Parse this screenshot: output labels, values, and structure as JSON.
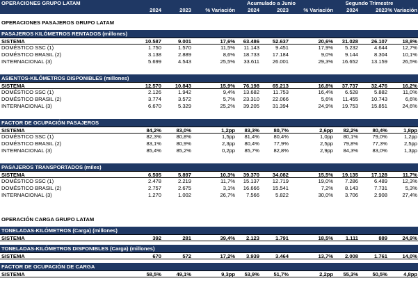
{
  "header": {
    "title": "OPERACIONES GRUPO LATAM",
    "groups": [
      "Acumulado a Junio",
      "Segundo Trimestre"
    ],
    "columns": [
      "2024",
      "2023",
      "% Variación",
      "2024",
      "2023",
      "% Variación",
      "2024",
      "2023",
      "% Variación"
    ]
  },
  "passenger_title": "OPERACIONES PASAJEROS GRUPO LATAM",
  "cargo_title": "OPERACIÓN CARGA GRUPO LATAM",
  "passenger_sections": [
    {
      "title": "PASAJEROS KILÓMETROS RENTADOS (millones)",
      "rows": [
        {
          "label": "SISTEMA",
          "v": [
            "10.587",
            "9.001",
            "17,6%",
            "63.486",
            "52.637",
            "20,6%",
            "31.028",
            "26.107",
            "18,8%"
          ]
        },
        {
          "label": "DOMÉSTICO SSC (1)",
          "v": [
            "1.750",
            "1.570",
            "11,5%",
            "11.143",
            "9.451",
            "17,9%",
            "5.232",
            "4.644",
            "12,7%"
          ]
        },
        {
          "label": "DOMÉSTICO BRASIL (2)",
          "v": [
            "3.138",
            "2.889",
            "8,6%",
            "18.733",
            "17.184",
            "9,0%",
            "9.144",
            "8.304",
            "10,1%"
          ]
        },
        {
          "label": "INTERNACIONAL (3)",
          "v": [
            "5.699",
            "4.543",
            "25,5%",
            "33.611",
            "26.001",
            "29,3%",
            "16.652",
            "13.159",
            "26,5%"
          ]
        }
      ]
    },
    {
      "title": "ASIENTOS-KILÓMETROS DISPONIBLES (millones)",
      "rows": [
        {
          "label": "SISTEMA",
          "v": [
            "12.570",
            "10.843",
            "15,9%",
            "76.198",
            "65.213",
            "16,8%",
            "37.737",
            "32.476",
            "16,2%"
          ]
        },
        {
          "label": "DOMÉSTICO SSC (1)",
          "v": [
            "2.126",
            "1.942",
            "9,4%",
            "13.682",
            "11.753",
            "16,4%",
            "6.528",
            "5.882",
            "11,0%"
          ]
        },
        {
          "label": "DOMÉSTICO BRASIL (2)",
          "v": [
            "3.774",
            "3.572",
            "5,7%",
            "23.310",
            "22.066",
            "5,6%",
            "11.455",
            "10.743",
            "6,6%"
          ]
        },
        {
          "label": "INTERNACIONAL (3)",
          "v": [
            "6.670",
            "5.329",
            "25,2%",
            "39.205",
            "31.394",
            "24,9%",
            "19.753",
            "15.851",
            "24,6%"
          ]
        }
      ]
    },
    {
      "title": "FACTOR DE OCUPACIÓN PASAJEROS",
      "rows": [
        {
          "label": "SISTEMA",
          "v": [
            "84,2%",
            "83,0%",
            "1,2pp",
            "83,3%",
            "80,7%",
            "2,6pp",
            "82,2%",
            "80,4%",
            "1,8pp"
          ]
        },
        {
          "label": "DOMÉSTICO SSC (1)",
          "v": [
            "82,3%",
            "80,8%",
            "1,5pp",
            "81,4%",
            "80,4%",
            "1,0pp",
            "80,1%",
            "79,0%",
            "1,2pp"
          ]
        },
        {
          "label": "DOMÉSTICO BRASIL (2)",
          "v": [
            "83,1%",
            "80,9%",
            "2,3pp",
            "80,4%",
            "77,9%",
            "2,5pp",
            "79,8%",
            "77,3%",
            "2,5pp"
          ]
        },
        {
          "label": "INTERNACIONAL (3)",
          "v": [
            "85,4%",
            "85,2%",
            "0,2pp",
            "85,7%",
            "82,8%",
            "2,9pp",
            "84,3%",
            "83,0%",
            "1,3pp"
          ]
        }
      ]
    },
    {
      "title": "PASAJEROS TRANSPORTADOS (miles)",
      "rows": [
        {
          "label": "SISTEMA",
          "v": [
            "6.505",
            "5.897",
            "10,3%",
            "39.370",
            "34.082",
            "15,5%",
            "19.135",
            "17.128",
            "11,7%"
          ]
        },
        {
          "label": "DOMÉSTICO SSC (1)",
          "v": [
            "2.478",
            "2.219",
            "11,7%",
            "15.137",
            "12.719",
            "19,0%",
            "7.286",
            "6.489",
            "12,3%"
          ]
        },
        {
          "label": "DOMÉSTICO BRASIL (2)",
          "v": [
            "2.757",
            "2.675",
            "3,1%",
            "16.666",
            "15.541",
            "7,2%",
            "8.143",
            "7.731",
            "5,3%"
          ]
        },
        {
          "label": "INTERNACIONAL (3)",
          "v": [
            "1.270",
            "1.002",
            "26,7%",
            "7.566",
            "5.822",
            "30,0%",
            "3.706",
            "2.908",
            "27,4%"
          ]
        }
      ]
    }
  ],
  "cargo_sections": [
    {
      "title": "TONELADAS-KILÓMETROS (Carga) (millones)",
      "rows": [
        {
          "label": "SISTEMA",
          "v": [
            "392",
            "281",
            "39,4%",
            "2.123",
            "1.791",
            "18,5%",
            "1.111",
            "889",
            "24,9%"
          ]
        }
      ]
    },
    {
      "title": "TONELADAS-KILÓMETROS DISPONIBLES (Carga) (millones)",
      "rows": [
        {
          "label": "SISTEMA",
          "v": [
            "670",
            "572",
            "17,2%",
            "3.939",
            "3.464",
            "13,7%",
            "2.008",
            "1.761",
            "14,0%"
          ]
        }
      ]
    },
    {
      "title": "FACTOR DE OCUPACIÓN DE CARGA",
      "rows": [
        {
          "label": "SISTEMA",
          "v": [
            "58,5%",
            "49,1%",
            "9,3pp",
            "53,9%",
            "51,7%",
            "2,2pp",
            "55,3%",
            "50,5%",
            "4,8pp"
          ]
        }
      ]
    }
  ]
}
